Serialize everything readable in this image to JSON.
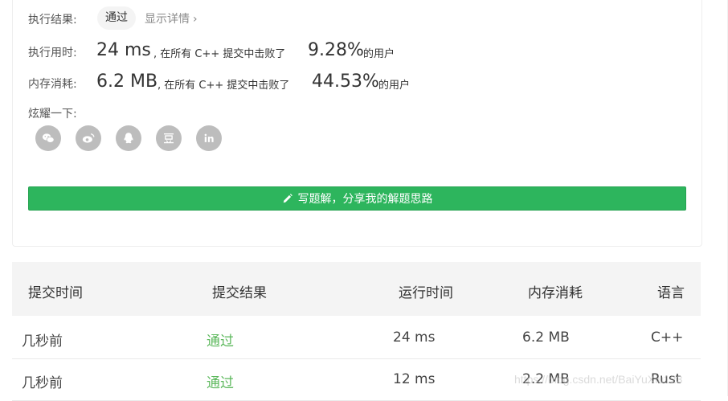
{
  "result": {
    "label": "执行结果:",
    "status": "通过",
    "details_link": "显示详情",
    "details_chevron": "›"
  },
  "runtime": {
    "label": "执行用时:",
    "value": "24 ms",
    "beat_text": ", 在所有 C++ 提交中击败了",
    "percent": "9.28%",
    "suffix": "的用户"
  },
  "memory": {
    "label": "内存消耗:",
    "value": "6.2 MB",
    "beat_text": ", 在所有 C++ 提交中击败了",
    "percent": "44.53%",
    "suffix": "的用户"
  },
  "share": {
    "label": "炫耀一下:",
    "icons": [
      "wechat-icon",
      "weibo-icon",
      "qq-icon",
      "douban-icon",
      "linkedin-icon"
    ],
    "button_label": "写题解，分享我的解题思路"
  },
  "table": {
    "headers": [
      "提交时间",
      "提交结果",
      "运行时间",
      "内存消耗",
      "语言"
    ],
    "rows": [
      [
        "几秒前",
        "通过",
        "24 ms",
        "6.2 MB",
        "C++"
      ],
      [
        "几秒前",
        "通过",
        "12 ms",
        "2.2 MB",
        "Rust"
      ]
    ]
  },
  "watermark": "https://blog.csdn.net/BaiYuXiu123",
  "colors": {
    "accent_green": "#2db55d",
    "pass_green": "#5cb85c",
    "icon_gray": "#bdbdbd",
    "header_bg": "#f4f4f4"
  }
}
